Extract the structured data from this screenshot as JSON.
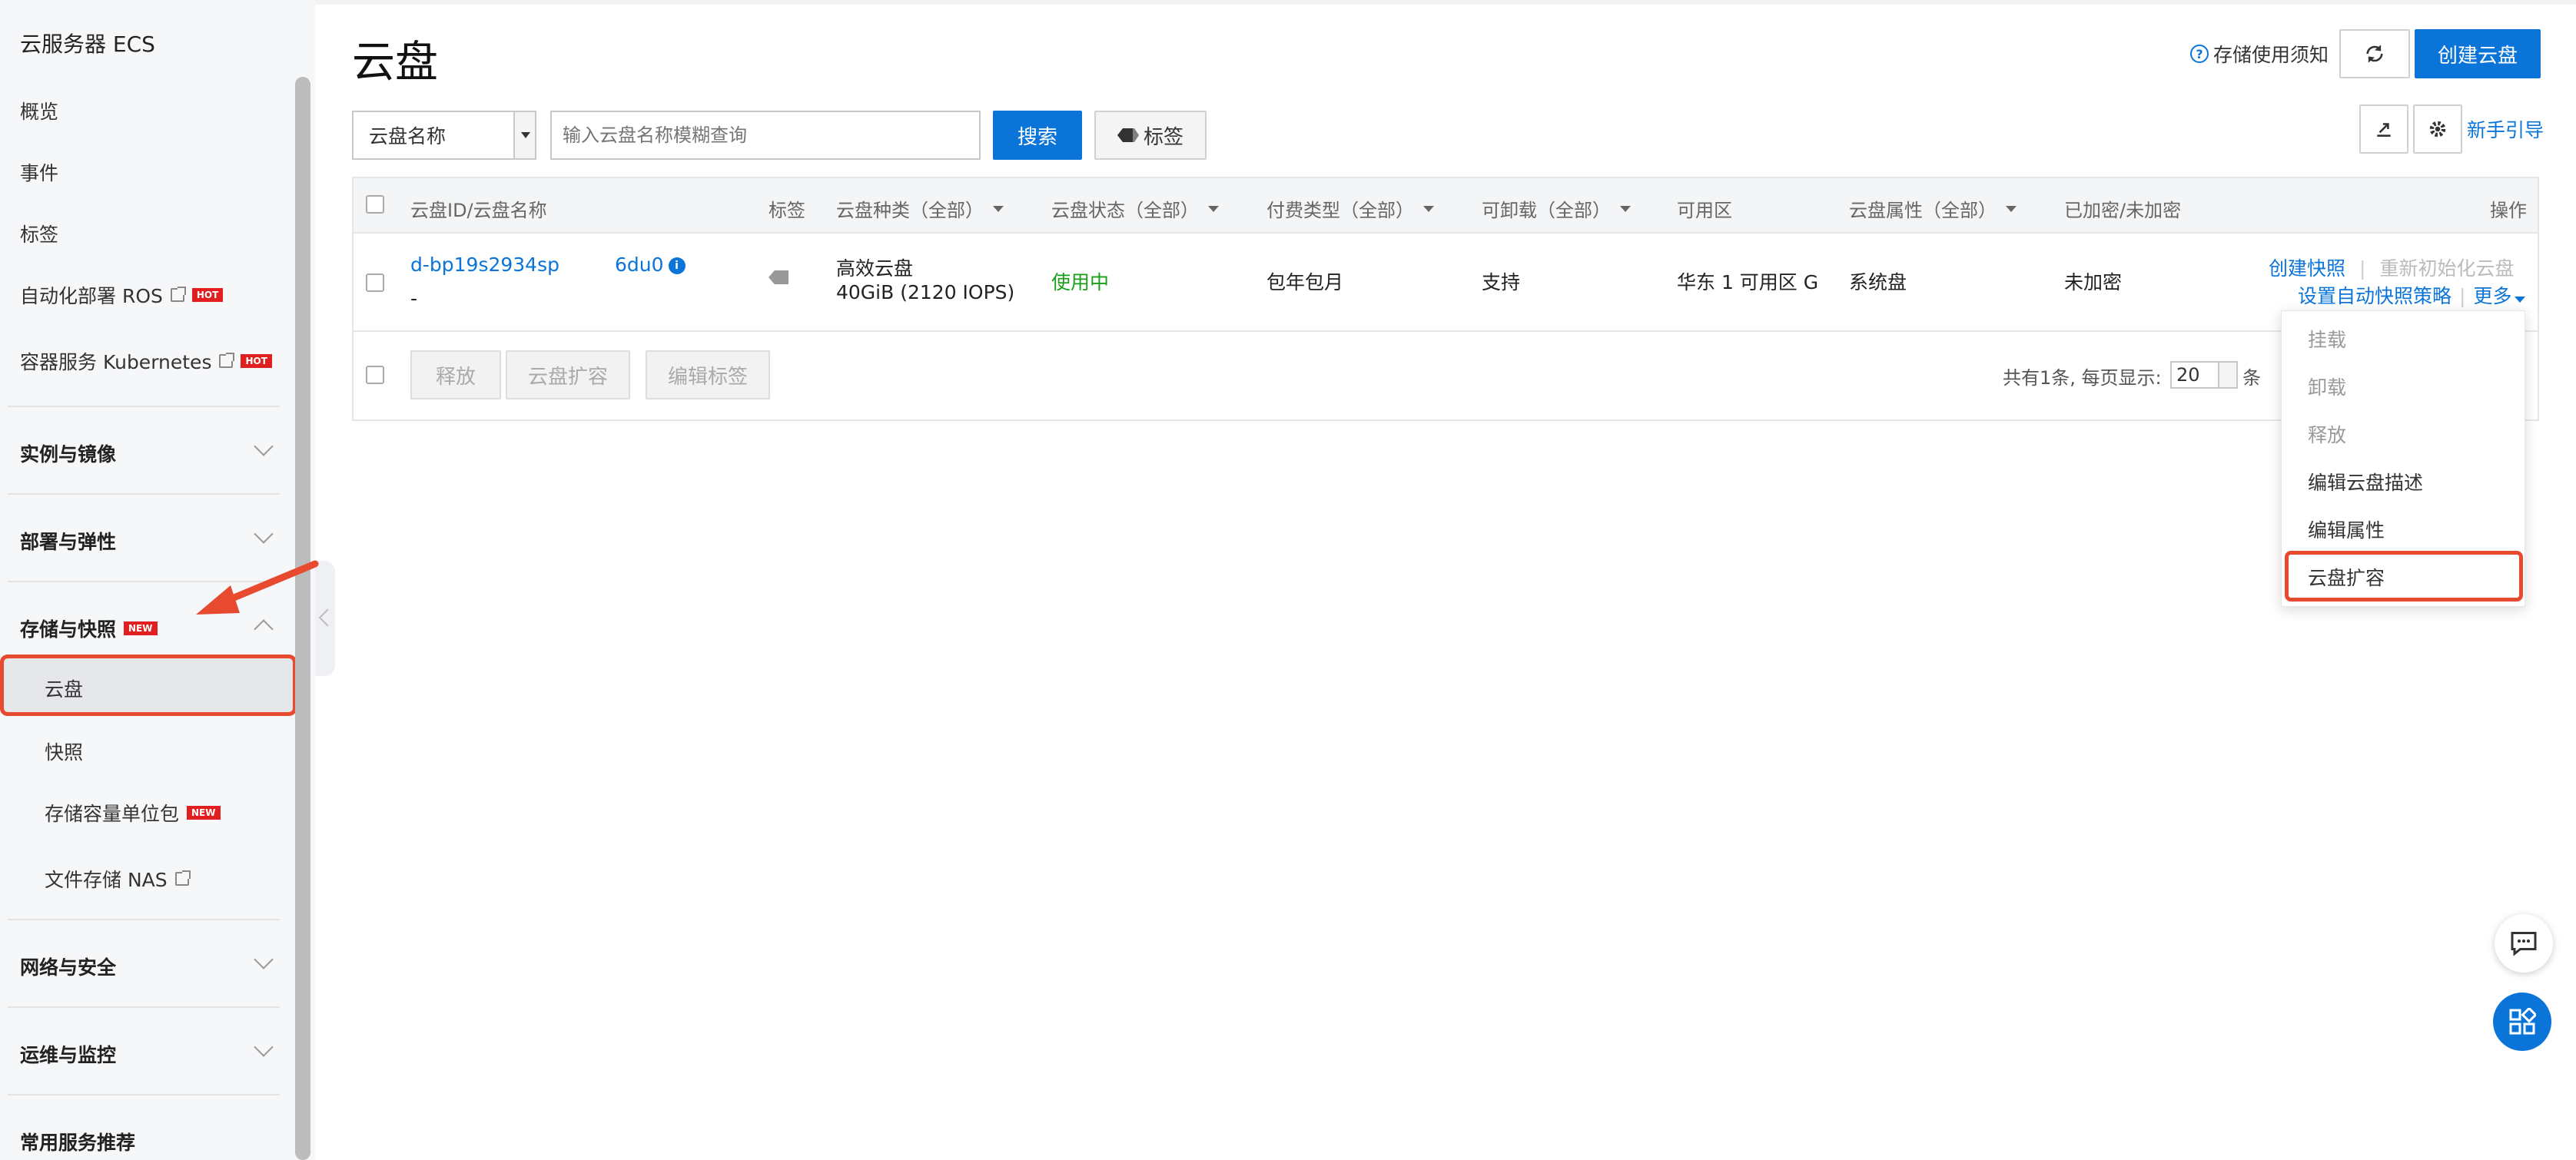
{
  "sidebar": {
    "title": "云服务器 ECS",
    "items": [
      {
        "label": "概览"
      },
      {
        "label": "事件"
      },
      {
        "label": "标签"
      },
      {
        "label": "自动化部署 ROS",
        "badge": "HOT"
      },
      {
        "label": "容器服务 Kubernetes",
        "badge": "HOT"
      }
    ],
    "groups": [
      {
        "label": "实例与镜像"
      },
      {
        "label": "部署与弹性"
      },
      {
        "label": "存储与快照",
        "badge": "NEW"
      },
      {
        "label": "网络与安全"
      },
      {
        "label": "运维与监控"
      },
      {
        "label": "常用服务推荐"
      }
    ],
    "storage_sub": [
      {
        "label": "云盘"
      },
      {
        "label": "快照"
      },
      {
        "label": "存储容量单位包",
        "badge": "NEW"
      },
      {
        "label": "文件存储 NAS"
      }
    ]
  },
  "header": {
    "title": "云盘",
    "notice": "存储使用须知",
    "create_button": "创建云盘",
    "guide_link": "新手引导"
  },
  "search": {
    "select_value": "云盘名称",
    "placeholder": "输入云盘名称模糊查询",
    "search_button": "搜索",
    "tag_button": "标签"
  },
  "table": {
    "columns": [
      "云盘ID/云盘名称",
      "标签",
      "云盘种类（全部）",
      "云盘状态（全部）",
      "付费类型（全部）",
      "可卸载（全部）",
      "可用区",
      "云盘属性（全部）",
      "已加密/未加密",
      "操作"
    ],
    "rows": [
      {
        "disk_id": "d-bp19s2934sp",
        "disk_id_suffix": "6du0",
        "name": "-",
        "type_line1": "高效云盘",
        "type_line2": "40GiB (2120 IOPS)",
        "status": "使用中",
        "billing": "包年包月",
        "detachable": "支持",
        "zone": "华东 1 可用区 G",
        "attribute": "系统盘",
        "encryption": "未加密",
        "actions": {
          "create_snapshot": "创建快照",
          "reinit": "重新初始化云盘",
          "auto_snapshot": "设置自动快照策略",
          "more": "更多"
        }
      }
    ],
    "footer": {
      "release": "释放",
      "expand": "云盘扩容",
      "edit_tags": "编辑标签",
      "total_text": "共有1条, 每页显示:",
      "page_size": "20",
      "unit": "条"
    }
  },
  "dropdown": {
    "items": [
      {
        "label": "挂载",
        "enabled": false
      },
      {
        "label": "卸载",
        "enabled": false
      },
      {
        "label": "释放",
        "enabled": false
      },
      {
        "label": "编辑云盘描述",
        "enabled": true
      },
      {
        "label": "编辑属性",
        "enabled": true
      },
      {
        "label": "云盘扩容",
        "enabled": true
      }
    ]
  },
  "colors": {
    "accent": "#ff6a00",
    "primary": "#0a74d9",
    "highlight": "#e84a30",
    "status_ok": "#1a9e1a"
  }
}
